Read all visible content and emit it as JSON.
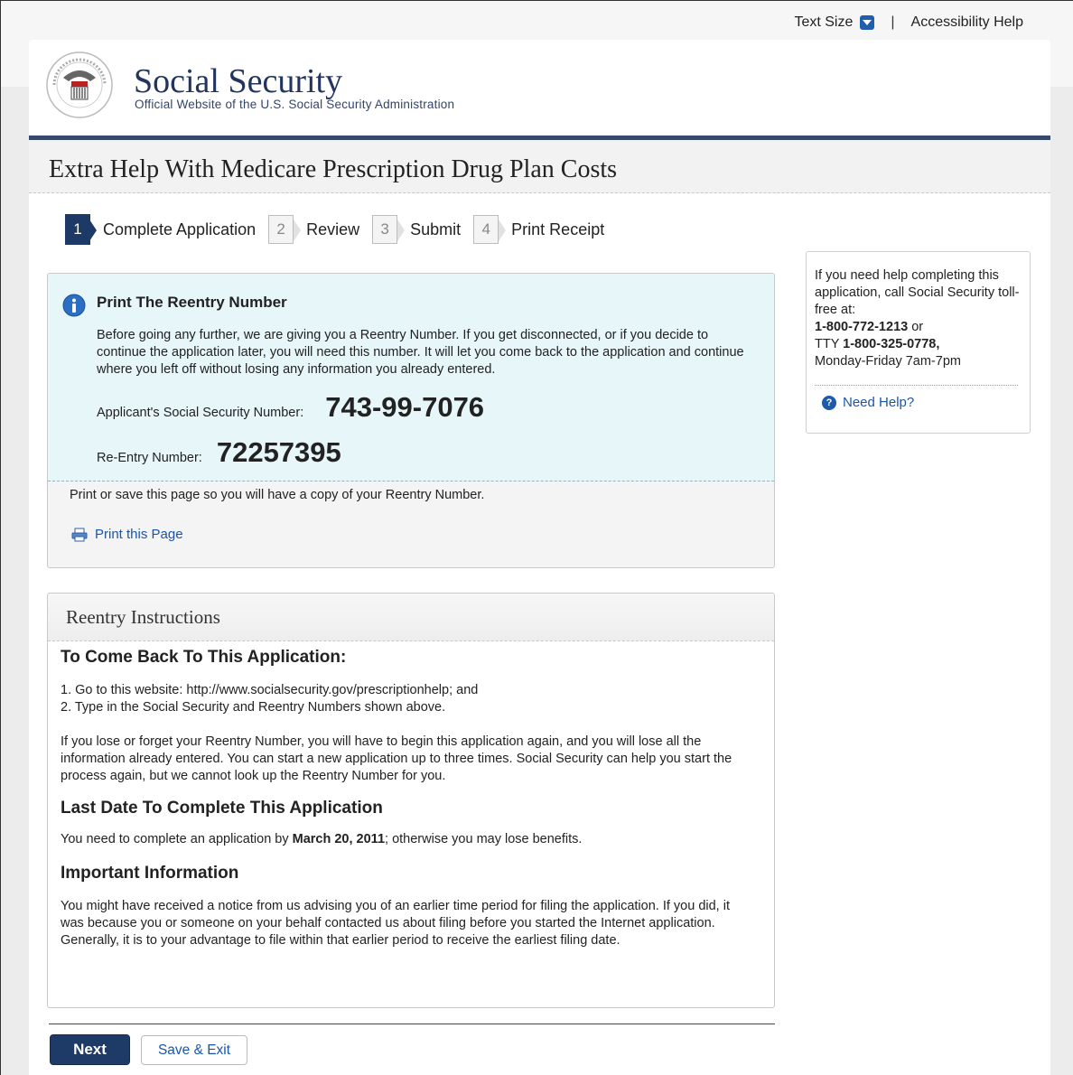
{
  "utility": {
    "text_size": "Text Size",
    "separator": "|",
    "accessibility": "Accessibility Help"
  },
  "brand": {
    "title": "Social Security",
    "subtitle": "Official Website of the U.S. Social Security Administration",
    "seal_text": "SOCIAL SECURITY ADMINISTRATION USA"
  },
  "page_title": "Extra Help With Medicare Prescription Drug Plan Costs",
  "steps": [
    {
      "num": "1",
      "label": "Complete Application",
      "active": true
    },
    {
      "num": "2",
      "label": "Review",
      "active": false
    },
    {
      "num": "3",
      "label": "Submit",
      "active": false
    },
    {
      "num": "4",
      "label": "Print Receipt",
      "active": false
    }
  ],
  "notice": {
    "heading": "Print The Reentry Number",
    "intro": "Before going any further, we are giving you a Reentry Number. If you get disconnected, or if you decide to continue the application later, you will need this number. It will let you come back to the application and continue where you left off without losing any information you already entered.",
    "ssn_label": "Applicant's Social Security Number:",
    "ssn_value": "743-99-7076",
    "reentry_label": "Re-Entry Number:",
    "reentry_value": "72257395",
    "save_note": "Print or save this page so you will have a copy of your Reentry Number.",
    "print_link": "Print this Page"
  },
  "instructions": {
    "heading": "Reentry Instructions",
    "come_back_heading": "To Come Back To This Application:",
    "step1": "1. Go to this website: http://www.socialsecurity.gov/prescriptionhelp; and",
    "step2": "2. Type in the Social Security and Reentry Numbers shown above.",
    "lose_para": "If you lose or forget your Reentry Number, you will have to begin this application again, and you will lose all the information already entered. You can start a new application up to three times. Social Security can help you start the process again, but we cannot look up the Reentry Number for you.",
    "last_date_heading": "Last Date To Complete This Application",
    "last_date_pre": "You need to complete an application by ",
    "last_date_value": "March 20, 2011",
    "last_date_post": "; otherwise you may lose benefits.",
    "important_heading": "Important Information",
    "important_para": "You might have received a notice from us advising you of an earlier time period for filing the application. If you did, it was because you or someone on your behalf contacted us about filing before you started the Internet application. Generally, it is to your advantage to file within that earlier period to receive the earliest filing date."
  },
  "sidebar": {
    "text": "If you need help completing this application, call Social Security toll-free at:",
    "phone": "1-800-772-1213",
    "or": " or",
    "tty_label": "TTY ",
    "tty": "1-800-325-0778,",
    "hours": "Monday-Friday 7am-7pm",
    "need_help": "Need Help?",
    "need_help_glyph": "?"
  },
  "buttons": {
    "next": "Next",
    "save_exit": "Save & Exit"
  },
  "colors": {
    "navy": "#1e3a66",
    "link": "#1a56a8",
    "notice_bg": "#e6f6f9"
  }
}
